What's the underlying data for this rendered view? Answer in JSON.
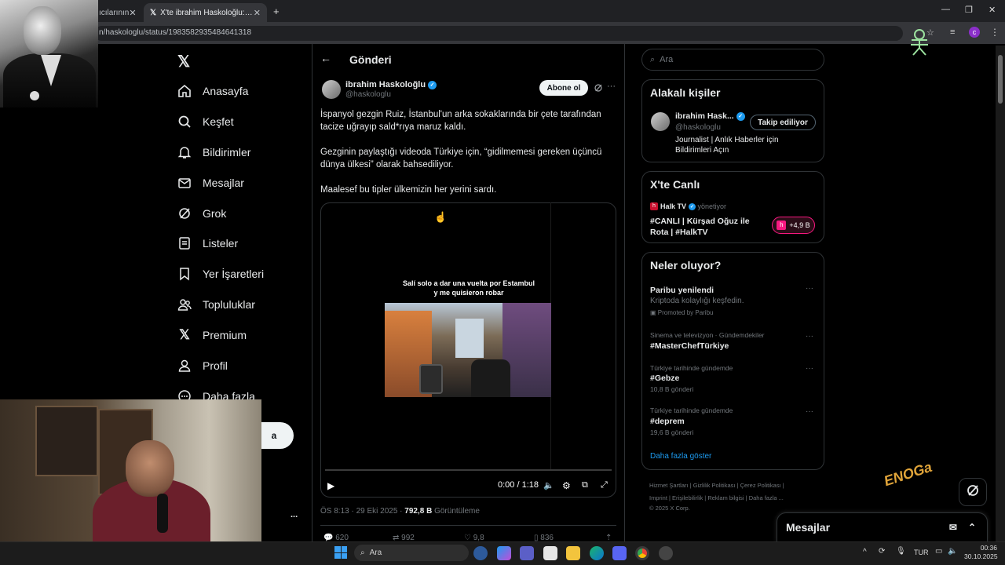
{
  "browser": {
    "tabs": [
      {
        "title": "ıcılarının"
      },
      {
        "title": "X'te ibrahim Haskoloğlu: \"İspan"
      }
    ],
    "url": "n/haskologlu/status/1983582935484641318",
    "profile_initial": "c"
  },
  "nav": {
    "items": [
      {
        "label": "Anasayfa",
        "icon": "home-icon"
      },
      {
        "label": "Keşfet",
        "icon": "search-icon"
      },
      {
        "label": "Bildirimler",
        "icon": "bell-icon"
      },
      {
        "label": "Mesajlar",
        "icon": "mail-icon"
      },
      {
        "label": "Grok",
        "icon": "grok-icon"
      },
      {
        "label": "Listeler",
        "icon": "list-icon"
      },
      {
        "label": "Yer İşaretleri",
        "icon": "bookmark-icon"
      },
      {
        "label": "Topluluklar",
        "icon": "people-icon"
      },
      {
        "label": "Premium",
        "icon": "x-logo-icon"
      },
      {
        "label": "Profil",
        "icon": "person-icon"
      },
      {
        "label": "Daha fazla",
        "icon": "more-circle-icon"
      }
    ],
    "post_button": "a",
    "more_dots": "..."
  },
  "main": {
    "header_title": "Gönderi",
    "author": {
      "name": "ibrahim Haskoloğlu",
      "handle": "@haskologlu"
    },
    "subscribe_label": "Abone ol",
    "paragraphs": [
      "İspanyol gezgin Ruiz, İstanbul'un arka sokaklarında bir çete tarafından tacize uğrayıp sald*rıya maruz kaldı.",
      "Gezginin paylaştığı videoda Türkiye için, “gidilmemesi gereken üçüncü dünya ülkesi” olarak bahsediliyor.",
      "Maalesef bu tipler ülkemizin her yerini sardı."
    ],
    "video": {
      "caption": "Salí solo a dar una vuelta por Estambul y me quisieron robar",
      "time": "0:00 / 1:18"
    },
    "meta": {
      "time": "ÖS 8:13 · 29 Eki 2025 · ",
      "views": "792,8 B",
      "views_label": " Görüntüleme"
    },
    "stats": {
      "replies": "620",
      "reposts": "992",
      "likes": "9,8",
      "bookmarks": "836"
    }
  },
  "sidebar": {
    "search_placeholder": "Ara",
    "related": {
      "title": "Alakalı kişiler",
      "name": "ibrahim Hask...",
      "handle": "@haskologlu",
      "follow_label": "Takip ediliyor",
      "bio": "Journalist | Anlık Haberler için Bildirimleri Açın"
    },
    "live": {
      "title": "X'te Canlı",
      "host": "Halk TV",
      "host_role": "yönetiyor",
      "stream": "#CANLI | Kürşad Oğuz ile Rota | #HalkTV",
      "listeners": "+4,9 B"
    },
    "trends": {
      "title": "Neler oluyor?",
      "items": [
        {
          "context": "",
          "name": "Paribu yenilendi",
          "sub": "Kriptoda kolaylığı keşfedin.",
          "promo": "Promoted by Paribu"
        },
        {
          "context": "Sinema ve televizyon · Gündemdekiler",
          "name": "#MasterChefTürkiye",
          "sub": "",
          "promo": ""
        },
        {
          "context": "Türkiye tarihinde gündemde",
          "name": "#Gebze",
          "sub": "10,8 B gönderi",
          "promo": ""
        },
        {
          "context": "Türkiye tarihinde gündemde",
          "name": "#deprem",
          "sub": "19,6 B gönderi",
          "promo": ""
        }
      ],
      "show_more": "Daha fazla göster"
    },
    "footer": {
      "line1": "Hizmet Şartları  |  Gizlilik Politikası  |  Çerez Politikası  |",
      "line2": "Imprint  |  Erişilebilirlik  |  Reklam bilgisi  |  Daha fazla ...",
      "line3": "© 2025 X Corp."
    }
  },
  "messages_drawer": {
    "label": "Mesajlar"
  },
  "overlay": {
    "signature": "ENOGa"
  },
  "taskbar": {
    "search": "Ara",
    "lang": "TUR",
    "time": "00:36",
    "date": "30.10.2025"
  },
  "colors": {
    "accent": "#1d9bf0",
    "live": "#f91880",
    "background": "#000000"
  }
}
